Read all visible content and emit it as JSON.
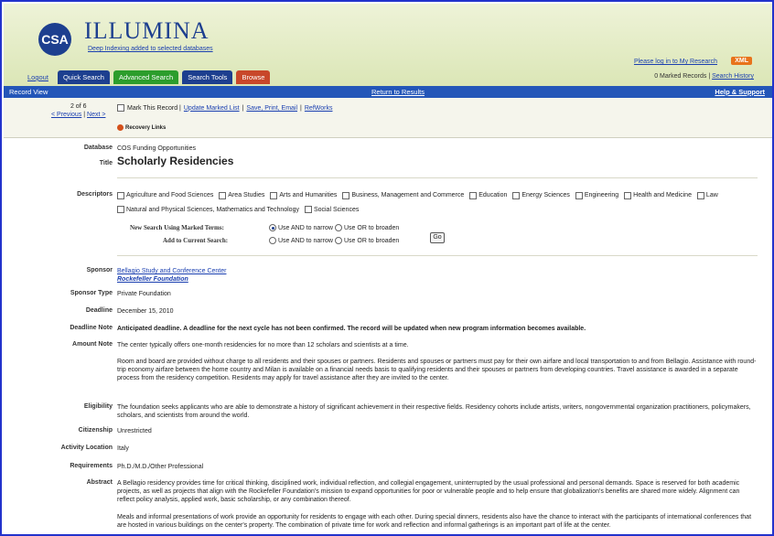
{
  "header": {
    "logo": "CSA",
    "brand": "ILLUMINA",
    "subbrand": "Deep Indexing added to selected databases",
    "login": "Please log in to My Research",
    "xml": "XML",
    "marked_prefix": "0 Marked Records |",
    "search_history": "Search History"
  },
  "tabs": {
    "logout": "Logout",
    "quick": "Quick Search",
    "advanced": "Advanced Search",
    "tools": "Search Tools",
    "browse": "Browse"
  },
  "bar": {
    "record_view": "Record View",
    "return": "Return to Results",
    "help": "Help & Support"
  },
  "nav": {
    "count": "2 of 6",
    "previous": "< Previous",
    "sep": "|",
    "next": "Next >",
    "mark": "Mark This Record |",
    "update": "Update Marked List",
    "pipe1": "|",
    "save": "Save, Print, Email",
    "pipe2": "|",
    "refworks": "RefWorks",
    "recovery": "Recovery Links"
  },
  "record": {
    "database_label": "Database",
    "database": "COS Funding Opportunities",
    "title_label": "Title",
    "title": "Scholarly Residencies",
    "descriptors_label": "Descriptors",
    "descriptors": [
      "Agriculture and Food Sciences",
      "Area Studies",
      "Arts and Humanities",
      "Business, Management and Commerce",
      "Education",
      "Energy Sciences",
      "Engineering",
      "Health and Medicine",
      "Law",
      "Natural and Physical Sciences, Mathematics and Technology",
      "Social Sciences"
    ],
    "new_search_label": "New Search Using Marked Terms:",
    "add_search_label": "Add to Current Search:",
    "use_and": "Use AND to narrow",
    "use_or": "Use OR to broaden",
    "go": "Go",
    "sponsor_label": "Sponsor",
    "sponsor1": "Bellagio Study and Conference Center",
    "sponsor2": "Rockefeller Foundation",
    "sponsor_type_label": "Sponsor Type",
    "sponsor_type": "Private Foundation",
    "deadline_label": "Deadline",
    "deadline": "December 15, 2010",
    "deadline_note_label": "Deadline Note",
    "deadline_note": "Anticipated deadline. A deadline for the next cycle has not been confirmed. The record will be updated when new program information becomes available.",
    "amount_note_label": "Amount Note",
    "amount_note1": "The center typically offers one-month residencies for no more than 12 scholars and scientists at a time.",
    "amount_note2": "Room and board are provided without charge to all residents and their spouses or partners. Residents and spouses or partners must pay for their own airfare and local transportation to and from Bellagio. Assistance with round-trip economy airfare between the home country and Milan is available on a financial needs basis to qualifying residents and their spouses or partners from developing countries. Travel assistance is awarded in a separate process from the residency competition. Residents may apply for travel assistance after they are invited to the center.",
    "eligibility_label": "Eligibility",
    "eligibility": "The foundation seeks applicants who are able to demonstrate a history of significant achievement in their respective fields. Residency cohorts include artists, writers, nongovernmental organization practitioners, policymakers, scholars, and scientists from around the world.",
    "citizenship_label": "Citizenship",
    "citizenship": "Unrestricted",
    "activity_label": "Activity Location",
    "activity": "Italy",
    "requirements_label": "Requirements",
    "requirements": "Ph.D./M.D./Other Professional",
    "abstract_label": "Abstract",
    "abstract1": "A Bellagio residency provides time for critical thinking, disciplined work, individual reflection, and collegial engagement, uninterrupted by the usual professional and personal demands. Space is reserved for both academic projects, as well as projects that align with the Rockefeller Foundation's mission to expand opportunities for poor or vulnerable people and to help ensure that globalization's benefits are shared more widely. Alignment can reflect policy analysis, applied work, basic scholarship, or any combination thereof.",
    "abstract2": "Meals and informal presentations of work provide an opportunity for residents to engage with each other. During special dinners, residents also have the chance to interact with the participants of international conferences that are hosted in various buildings on the center's property. The combination of private time for work and reflection and informal gatherings is an important part of life at the center."
  }
}
